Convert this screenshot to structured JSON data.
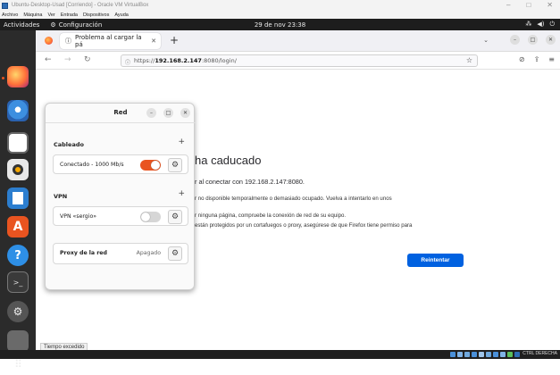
{
  "vbox": {
    "title": "Ubuntu-Desktop-Usad [Corriendo] - Oracle VM VirtualBox",
    "menu": [
      "Archivo",
      "Máquina",
      "Ver",
      "Entrada",
      "Dispositivos",
      "Ayuda"
    ],
    "host_key": "CTRL DERECHA"
  },
  "topbar": {
    "activities": "Actividades",
    "app_name": "Configuración",
    "clock": "29 de nov  23:38"
  },
  "browser": {
    "tab_title": "Problema al cargar la pá",
    "url_prefix": "https://",
    "url_host": "192.168.2.147",
    "url_rest": ":8080/login/"
  },
  "error_page": {
    "title": "ha caducado",
    "subtitle": "r al conectar con 192.168.2.147:8080.",
    "line1": "r no disponible temporalmente o demasiado ocupado. Vuelva a intentarlo en unos",
    "line2": "r ninguna página, compruebe la conexión de red de su equipo.",
    "line3": "están protegidos por un cortafuegos o proxy, asegúrese de que Firefox tiene permiso para",
    "retry_label": "Reintentar"
  },
  "status_text": "Tiempo excedido",
  "network_panel": {
    "title": "Red",
    "wired_section": "Cableado",
    "wired_status": "Conectado - 1000 Mb/s",
    "wired_on": true,
    "vpn_section": "VPN",
    "vpn_name": "VPN «sergio»",
    "vpn_on": false,
    "proxy_label": "Proxy de la red",
    "proxy_state": "Apagado"
  },
  "colors": {
    "toggle_on": "#e95420",
    "toggle_off": "#d6d6d6",
    "retry_button": "#0061e0",
    "dock_bg": "#2b2b2b",
    "topbar_bg": "#1d1d1d"
  }
}
